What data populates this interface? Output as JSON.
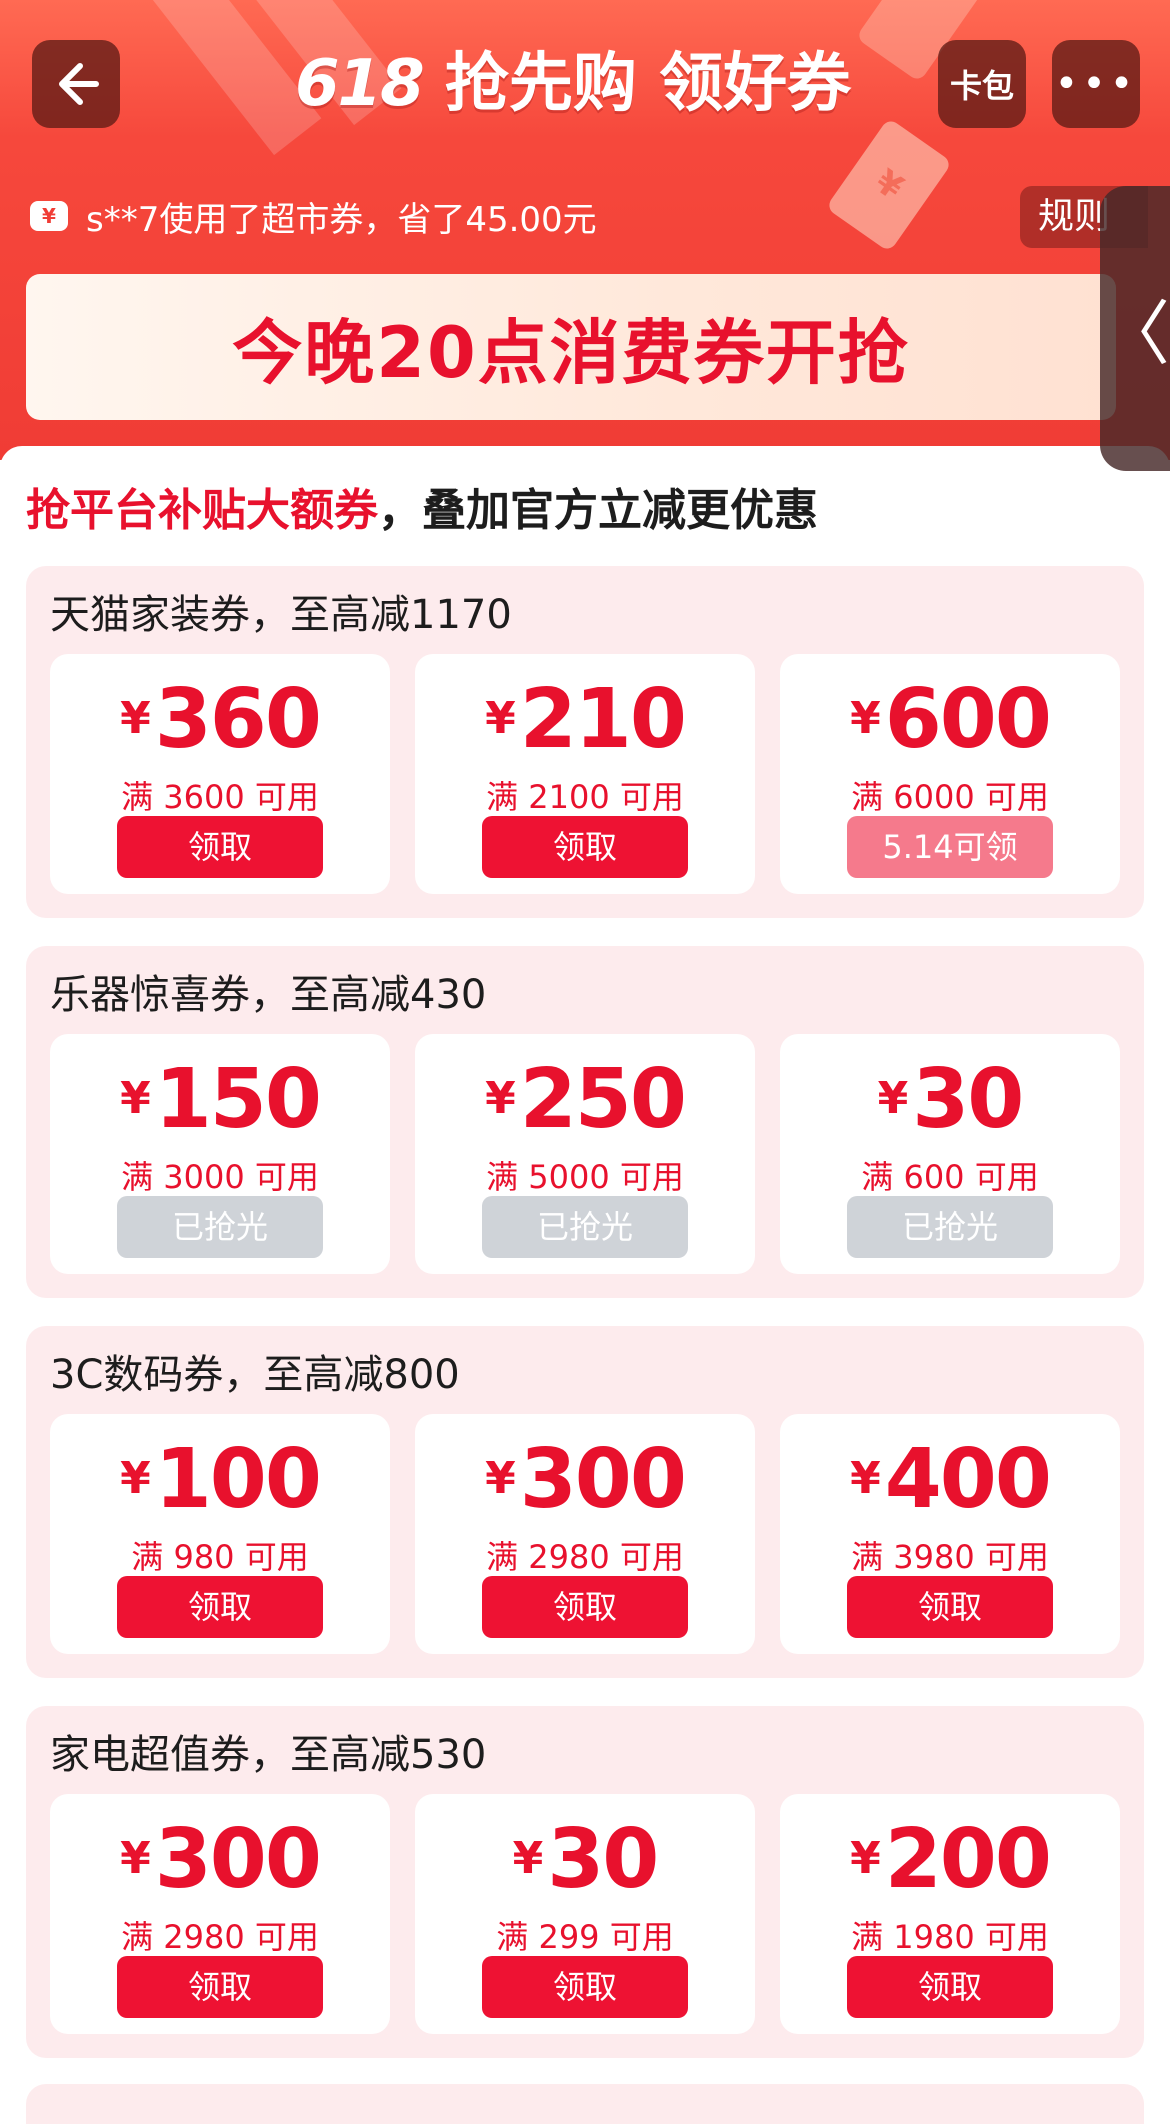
{
  "header": {
    "title_num": "618",
    "title_text": "抢先购 领好券",
    "wallet_label": "卡包",
    "more_label": "•••",
    "back_icon": "←",
    "ticker_text": "s**7使用了超市券，省了45.00元",
    "rules_label": "规则",
    "side_tab_icon": "〈",
    "banner_text": "今晚20点消费券开抢"
  },
  "heading": {
    "highlight": "抢平台补贴大额券",
    "rest": "，叠加官方立减更优惠"
  },
  "colors": {
    "brand_red": "#e8112d",
    "button_red": "#ee1233",
    "button_pink": "#f57a8c",
    "button_gray": "#cfd3d8",
    "group_bg": "#fdebed"
  },
  "currency_symbol": "¥",
  "groups": [
    {
      "title": "天猫家装券，至高减1170",
      "coupons": [
        {
          "amount": "360",
          "condition": "满 3600 可用",
          "button": "领取",
          "state": "available"
        },
        {
          "amount": "210",
          "condition": "满 2100 可用",
          "button": "领取",
          "state": "available"
        },
        {
          "amount": "600",
          "condition": "满 6000 可用",
          "button": "5.14可领",
          "state": "upcoming"
        }
      ]
    },
    {
      "title": "乐器惊喜券，至高减430",
      "coupons": [
        {
          "amount": "150",
          "condition": "满 3000 可用",
          "button": "已抢光",
          "state": "soldout"
        },
        {
          "amount": "250",
          "condition": "满 5000 可用",
          "button": "已抢光",
          "state": "soldout"
        },
        {
          "amount": "30",
          "condition": "满 600 可用",
          "button": "已抢光",
          "state": "soldout"
        }
      ]
    },
    {
      "title": "3C数码券，至高减800",
      "coupons": [
        {
          "amount": "100",
          "condition": "满 980 可用",
          "button": "领取",
          "state": "available"
        },
        {
          "amount": "300",
          "condition": "满 2980 可用",
          "button": "领取",
          "state": "available"
        },
        {
          "amount": "400",
          "condition": "满 3980 可用",
          "button": "领取",
          "state": "available"
        }
      ]
    },
    {
      "title": "家电超值券，至高减530",
      "coupons": [
        {
          "amount": "300",
          "condition": "满 2980 可用",
          "button": "领取",
          "state": "available"
        },
        {
          "amount": "30",
          "condition": "满 299 可用",
          "button": "领取",
          "state": "available"
        },
        {
          "amount": "200",
          "condition": "满 1980 可用",
          "button": "领取",
          "state": "available"
        }
      ]
    }
  ]
}
